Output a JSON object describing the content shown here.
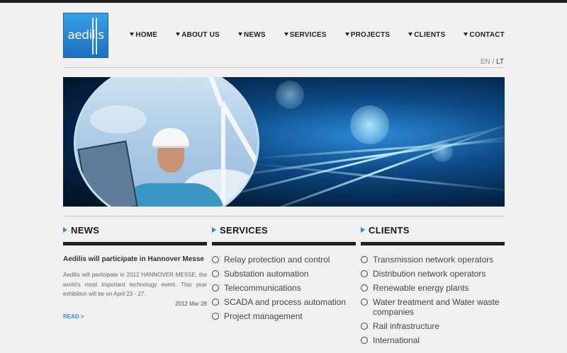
{
  "logo": {
    "text": "aedilis"
  },
  "nav": {
    "items": [
      {
        "label": "HOME"
      },
      {
        "label": "ABOUT US"
      },
      {
        "label": "NEWS"
      },
      {
        "label": "SERVICES"
      },
      {
        "label": "PROJECTS"
      },
      {
        "label": "CLIENTS"
      },
      {
        "label": "CONTACT"
      }
    ]
  },
  "lang": {
    "en": "EN",
    "separator": "/",
    "lt": "LT",
    "active": "LT"
  },
  "news": {
    "heading": "NEWS",
    "title": "Aedilis will participate in Hannover Messe",
    "text": "Aedilis will participate in 2012 HANNOVER MESSE, the world's most important technology event. This year exhibition will be on April 23 - 27.",
    "date": "2012 Mar 28",
    "read_more": "READ >"
  },
  "services": {
    "heading": "SERVICES",
    "items": [
      "Relay protection and control",
      "Substation automation",
      "Telecommunications",
      "SCADA and process automation",
      "Project management"
    ]
  },
  "clients": {
    "heading": "CLIENTS",
    "items": [
      "Transmission network operators",
      "Distribution network operators",
      "Renewable energy plants",
      "Water treatment and Water waste companies",
      "Rail infrastructure",
      "International"
    ]
  },
  "colors": {
    "accent": "#2d8fd8",
    "topbar": "#1b1b1b",
    "background": "#f1f1f1"
  }
}
